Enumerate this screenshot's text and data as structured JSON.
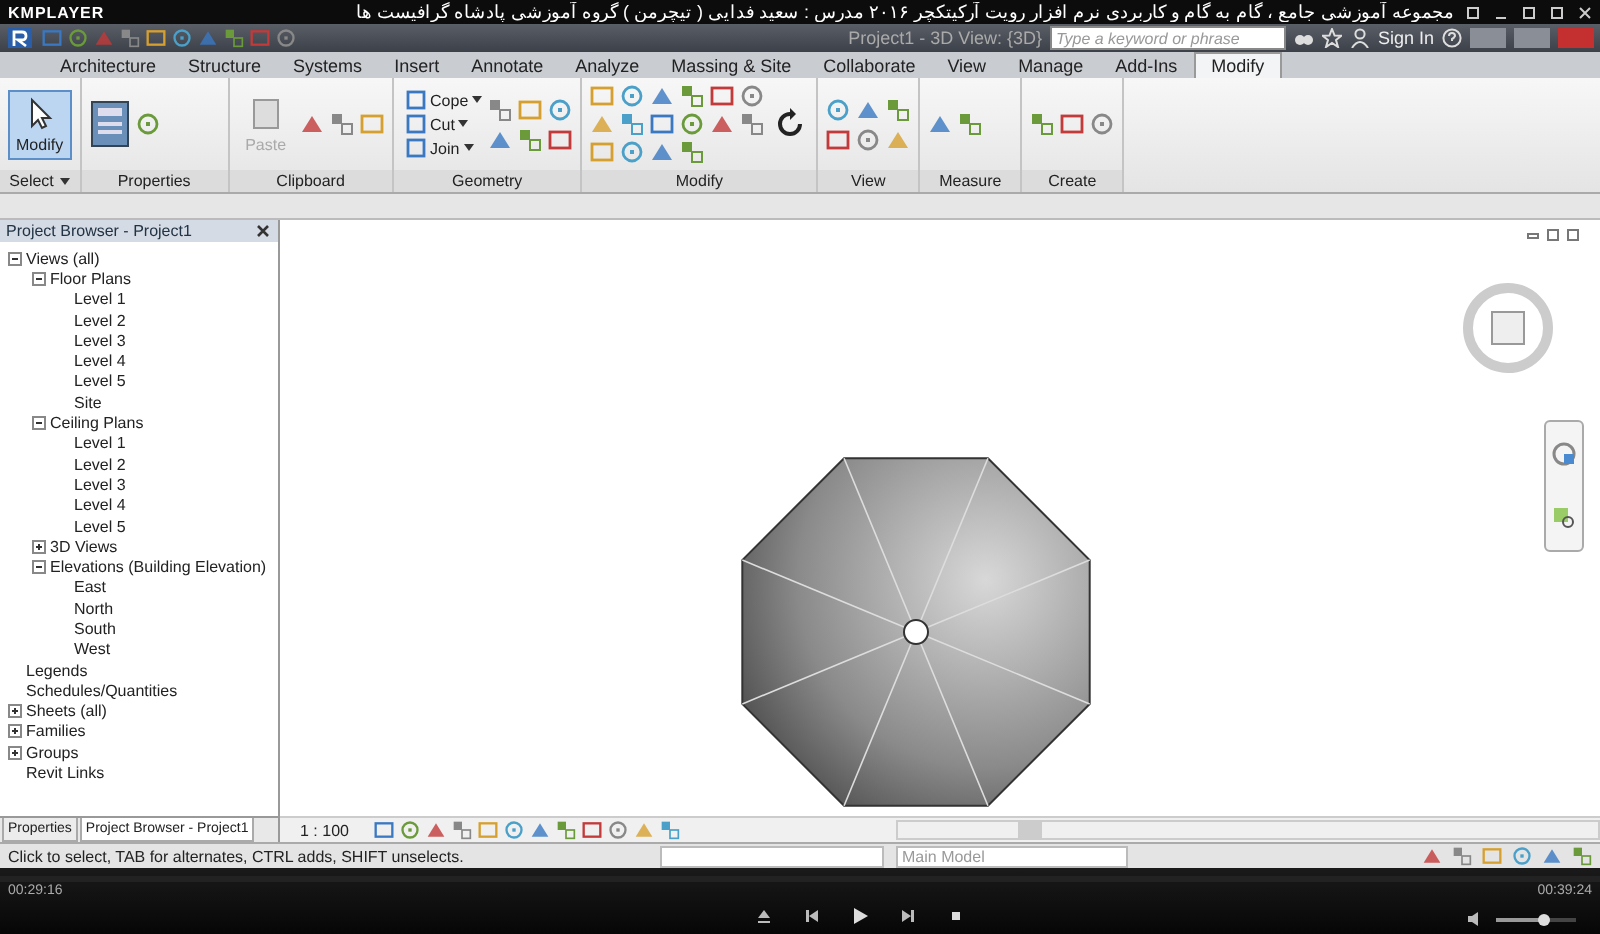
{
  "player": {
    "name": "KMPLAYER",
    "title": "مجموعه آموزشی جامع ، گام به گام و کاربردی نرم افزار رویت آرکیتکچر ۲۰۱۶  مدرس : سعید فدایی ( تیچرمن ) گروه آموزشی پادشاه گرافیست ها",
    "elapsed": "00:29:16",
    "total": "00:39:24",
    "volume": {
      "level": 0.6
    }
  },
  "app": {
    "title": "Project1 - 3D View: {3D}",
    "search": {
      "placeholder": "Type a keyword or phrase"
    },
    "sign_in": "Sign In"
  },
  "tabs": [
    {
      "label": "Architecture",
      "selected": false
    },
    {
      "label": "Structure",
      "selected": false
    },
    {
      "label": "Systems",
      "selected": false
    },
    {
      "label": "Insert",
      "selected": false
    },
    {
      "label": "Annotate",
      "selected": false
    },
    {
      "label": "Analyze",
      "selected": false
    },
    {
      "label": "Massing & Site",
      "selected": false
    },
    {
      "label": "Collaborate",
      "selected": false
    },
    {
      "label": "View",
      "selected": false
    },
    {
      "label": "Manage",
      "selected": false
    },
    {
      "label": "Add-Ins",
      "selected": false
    },
    {
      "label": "Modify",
      "selected": true
    }
  ],
  "ribbon": [
    {
      "label": "Select",
      "tools": [
        {
          "label": "Modify",
          "kind": "large",
          "selected": true,
          "disabled": false
        }
      ]
    },
    {
      "label": "Properties"
    },
    {
      "label": "Clipboard",
      "tools": [
        {
          "label": "Paste",
          "kind": "large",
          "selected": false,
          "disabled": true
        }
      ]
    },
    {
      "label": "Geometry",
      "tools": [
        {
          "label": "Cope",
          "kind": "small",
          "selected": false,
          "disabled": false
        },
        {
          "label": "Cut",
          "kind": "small",
          "selected": false,
          "disabled": false
        },
        {
          "label": "Join",
          "kind": "small",
          "selected": false,
          "disabled": false
        }
      ]
    },
    {
      "label": "Modify"
    },
    {
      "label": "View"
    },
    {
      "label": "Measure"
    },
    {
      "label": "Create"
    }
  ],
  "browser": {
    "title": "Project Browser - Project1",
    "tree": [
      {
        "label": "Views (all)",
        "expanded": true,
        "children": [
          {
            "label": "Floor Plans",
            "expanded": true,
            "children": [
              {
                "label": "Level 1"
              },
              {
                "label": "Level 2"
              },
              {
                "label": "Level 3"
              },
              {
                "label": "Level 4"
              },
              {
                "label": "Level 5"
              },
              {
                "label": "Site"
              }
            ]
          },
          {
            "label": "Ceiling Plans",
            "expanded": true,
            "children": [
              {
                "label": "Level 1"
              },
              {
                "label": "Level 2"
              },
              {
                "label": "Level 3"
              },
              {
                "label": "Level 4"
              },
              {
                "label": "Level 5"
              }
            ]
          },
          {
            "label": "3D Views",
            "expanded": false
          },
          {
            "label": "Elevations (Building Elevation)",
            "expanded": true,
            "children": [
              {
                "label": "East"
              },
              {
                "label": "North"
              },
              {
                "label": "South"
              },
              {
                "label": "West"
              }
            ]
          }
        ]
      },
      {
        "label": "Legends"
      },
      {
        "label": "Schedules/Quantities"
      },
      {
        "label": "Sheets (all)",
        "expanded": false
      },
      {
        "label": "Families",
        "expanded": false
      },
      {
        "label": "Groups",
        "expanded": false
      },
      {
        "label": "Revit Links"
      }
    ],
    "tabs": [
      {
        "label": "Properties",
        "selected": false
      },
      {
        "label": "Project Browser - Project1",
        "selected": true
      }
    ]
  },
  "view": {
    "scale": "1 : 100"
  },
  "status_bar": {
    "message": "Click to select, TAB for alternates, CTRL adds, SHIFT unselects.",
    "model": "Main Model"
  }
}
